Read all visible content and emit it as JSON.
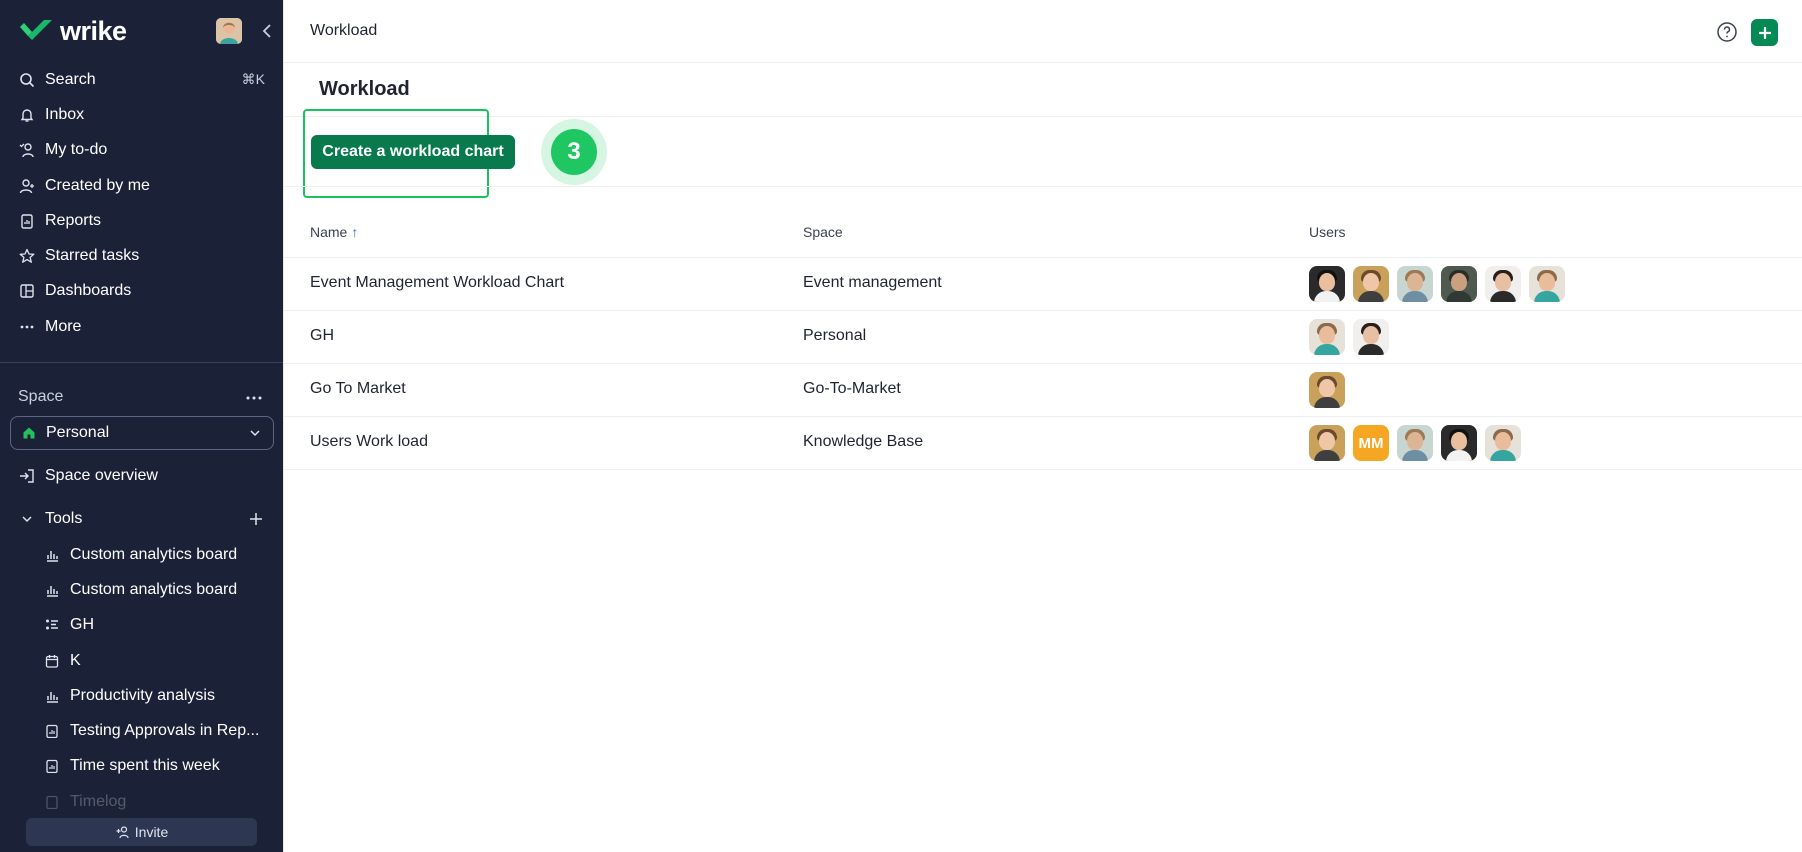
{
  "brand": {
    "name": "wrike",
    "accent": "#068a55"
  },
  "sidebar": {
    "nav": [
      {
        "label": "Search",
        "icon": "search-icon",
        "shortcut": "⌘K"
      },
      {
        "label": "Inbox",
        "icon": "bell-icon"
      },
      {
        "label": "My to-do",
        "icon": "todo-icon"
      },
      {
        "label": "Created by me",
        "icon": "user-plus-icon"
      },
      {
        "label": "Reports",
        "icon": "report-icon"
      },
      {
        "label": "Starred tasks",
        "icon": "star-icon"
      },
      {
        "label": "Dashboards",
        "icon": "dashboard-icon"
      },
      {
        "label": "More",
        "icon": "more-icon"
      }
    ],
    "space_label": "Space",
    "space_selected": "Personal",
    "space_overview": "Space overview",
    "tools_label": "Tools",
    "tools": [
      {
        "label": "Custom analytics board",
        "icon": "analytics-icon"
      },
      {
        "label": "Custom analytics board",
        "icon": "analytics-icon"
      },
      {
        "label": "GH",
        "icon": "workload-icon"
      },
      {
        "label": "K",
        "icon": "calendar-icon"
      },
      {
        "label": "Productivity analysis",
        "icon": "analytics-icon"
      },
      {
        "label": "Testing Approvals in Rep...",
        "icon": "report-icon"
      },
      {
        "label": "Time spent this week",
        "icon": "report-icon"
      },
      {
        "label": "Timelog",
        "icon": "report-icon"
      }
    ],
    "invite_label": "Invite"
  },
  "header": {
    "breadcrumb": "Workload"
  },
  "page": {
    "title": "Workload",
    "cta_label": "Create a workload chart",
    "step_number": "3"
  },
  "table": {
    "columns": {
      "name": "Name",
      "space": "Space",
      "users": "Users"
    },
    "sort_indicator": "↑",
    "rows": [
      {
        "name": "Event Management Workload Chart",
        "space": "Event management",
        "users": [
          "photo",
          "photo",
          "photo",
          "photo",
          "photo",
          "photo"
        ]
      },
      {
        "name": "GH",
        "space": "Personal",
        "users": [
          "photo",
          "photo"
        ]
      },
      {
        "name": "Go To Market",
        "space": "Go-To-Market",
        "users": [
          "photo"
        ]
      },
      {
        "name": "Users Work load",
        "space": "Knowledge Base",
        "users": [
          "photo",
          "MM",
          "photo",
          "photo",
          "photo"
        ]
      }
    ]
  }
}
